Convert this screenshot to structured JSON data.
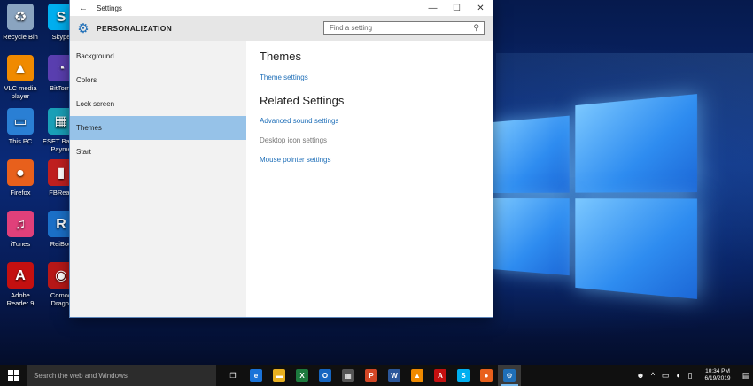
{
  "desktop": {
    "icons": [
      {
        "label": "Recycle Bin",
        "glyph": "♻",
        "color": "#8aa4c0"
      },
      {
        "label": "Skype",
        "glyph": "S",
        "color": "#00aff0"
      },
      {
        "label": "VLC media player",
        "glyph": "▲",
        "color": "#f08a00"
      },
      {
        "label": "BitTorre",
        "glyph": "◔",
        "color": "#5a3fb0"
      },
      {
        "label": "This PC",
        "glyph": "▭",
        "color": "#2a7fd4"
      },
      {
        "label": "ESET Ban & Payme",
        "glyph": "▦",
        "color": "#1aa0b8"
      },
      {
        "label": "Firefox",
        "glyph": "●",
        "color": "#e8601c"
      },
      {
        "label": "FBRead",
        "glyph": "▮",
        "color": "#c02020"
      },
      {
        "label": "iTunes",
        "glyph": "♫",
        "color": "#e0407a"
      },
      {
        "label": "ReiBoo",
        "glyph": "R",
        "color": "#1b70c8"
      },
      {
        "label": "Adobe Reader 9",
        "glyph": "A",
        "color": "#c41010"
      },
      {
        "label": "Comod Dragor",
        "glyph": "◉",
        "color": "#b81818"
      }
    ]
  },
  "window": {
    "title": "Settings",
    "back_glyph": "←",
    "minimize_glyph": "—",
    "maximize_glyph": "☐",
    "close_glyph": "✕",
    "header": {
      "heading": "PERSONALIZATION",
      "search_placeholder": "Find a setting"
    },
    "nav": [
      {
        "label": "Background",
        "active": false
      },
      {
        "label": "Colors",
        "active": false
      },
      {
        "label": "Lock screen",
        "active": false
      },
      {
        "label": "Themes",
        "active": true
      },
      {
        "label": "Start",
        "active": false
      }
    ],
    "content": {
      "themes_heading": "Themes",
      "theme_settings_link": "Theme settings",
      "related_heading": "Related Settings",
      "advanced_sound_link": "Advanced sound settings",
      "desktop_icon_link": "Desktop icon settings",
      "mouse_pointer_link": "Mouse pointer settings"
    }
  },
  "taskbar": {
    "search_placeholder": "Search the web and Windows",
    "apps": [
      {
        "name": "task-view",
        "glyph": "❐",
        "color": "transparent"
      },
      {
        "name": "edge",
        "glyph": "e",
        "color": "#1a73d8"
      },
      {
        "name": "file-explorer",
        "glyph": "▬",
        "color": "#e8b020"
      },
      {
        "name": "excel",
        "glyph": "X",
        "color": "#1d7a3e"
      },
      {
        "name": "outlook",
        "glyph": "O",
        "color": "#1565c0"
      },
      {
        "name": "calculator",
        "glyph": "▦",
        "color": "#555555"
      },
      {
        "name": "powerpoint",
        "glyph": "P",
        "color": "#d24726"
      },
      {
        "name": "word",
        "glyph": "W",
        "color": "#2b579a"
      },
      {
        "name": "vlc",
        "glyph": "▲",
        "color": "#f08a00"
      },
      {
        "name": "acrobat",
        "glyph": "A",
        "color": "#c41010"
      },
      {
        "name": "skype",
        "glyph": "S",
        "color": "#00aff0"
      },
      {
        "name": "firefox",
        "glyph": "●",
        "color": "#e8601c"
      },
      {
        "name": "settings",
        "glyph": "⚙",
        "color": "#1f6fb8"
      }
    ],
    "time": "10:34 PM",
    "date": "6/19/2019"
  }
}
